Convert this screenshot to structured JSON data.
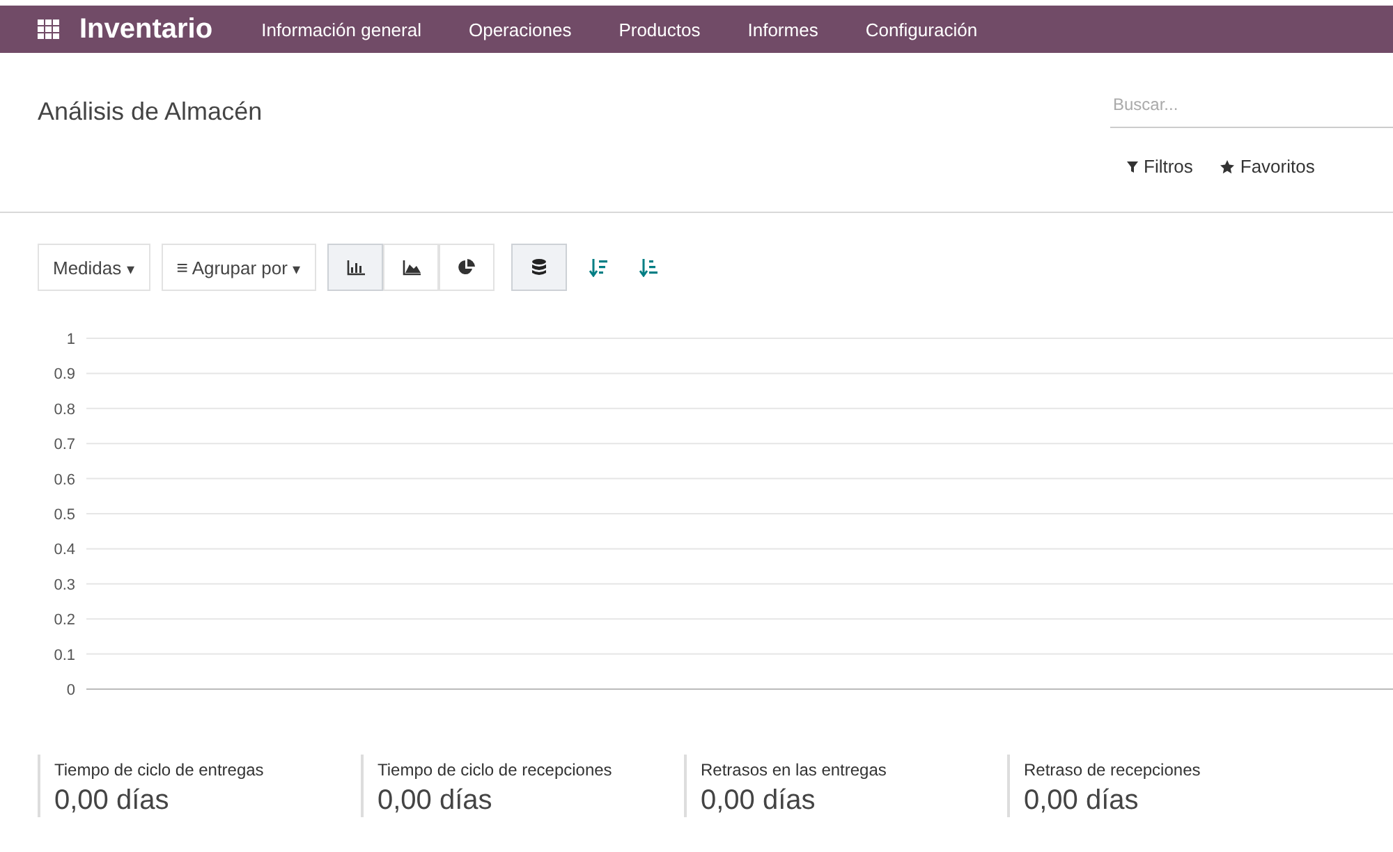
{
  "navbar": {
    "app_name": "Inventario",
    "menu": [
      "Información general",
      "Operaciones",
      "Productos",
      "Informes",
      "Configuración"
    ]
  },
  "page": {
    "title": "Análisis de Almacén"
  },
  "search": {
    "placeholder": "Buscar..."
  },
  "search_options": [
    "Filtros",
    "Favoritos"
  ],
  "toolbar": {
    "measures": {
      "label": "Medidas",
      "caret": "▾"
    },
    "group_by": {
      "icon": "≡",
      "label": "Agrupar por",
      "caret": "▾"
    },
    "views": [
      {
        "kind": "bar",
        "selected": true
      },
      {
        "kind": "area",
        "selected": false
      },
      {
        "kind": "pie",
        "selected": false
      }
    ],
    "stacked": {
      "on": true
    },
    "sort": [
      {
        "kind": "ascending"
      },
      {
        "kind": "descending"
      }
    ]
  },
  "chart": {
    "chart_data": {
      "type": "bar",
      "grid": true,
      "categories": [
        null
      ],
      "values": [
        null
      ],
      "ylim": [
        0,
        1
      ],
      "yticks": [
        0,
        0.1,
        0.2,
        0.3,
        0.4,
        0.5,
        0.6,
        0.7,
        0.8,
        0.9,
        1
      ]
    }
  },
  "kpis": [
    {
      "label": "Tiempo de ciclo de entregas",
      "value": "0,00 días"
    },
    {
      "label": "Tiempo de ciclo de recepciones",
      "value": "0,00 días"
    },
    {
      "label": "Retrasos en las entregas",
      "value": "0,00 días"
    },
    {
      "label": "Retraso de recepciones",
      "value": "0,00 días"
    }
  ]
}
